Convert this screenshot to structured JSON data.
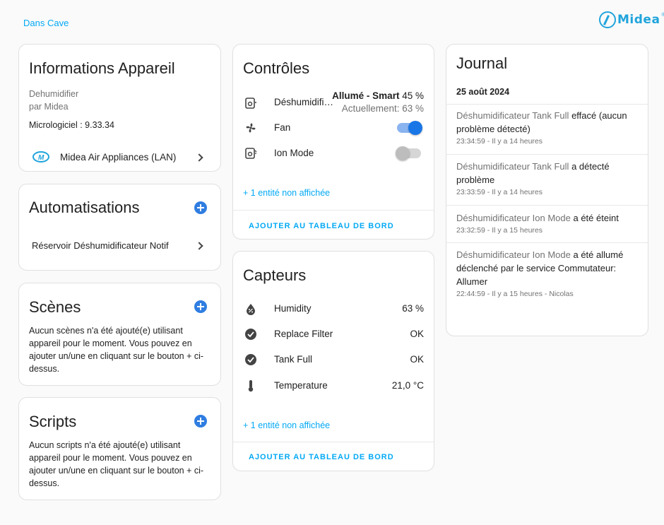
{
  "header": {
    "area_link": "Dans Cave",
    "brand_name": "Midea",
    "brand_reg": "®",
    "brand_color": "#20a4dc"
  },
  "device_info": {
    "title": "Informations Appareil",
    "model": "Dehumidifier",
    "manufacturer": "par Midea",
    "firmware": "Micrologiciel : 9.33.34",
    "integration": "Midea Air Appliances (LAN)"
  },
  "automations": {
    "title": "Automatisations",
    "items": [
      "Réservoir Déshumidificateur Notif"
    ]
  },
  "scenes": {
    "title": "Scènes",
    "empty_text": "Aucun scènes n'a été ajouté(e) utilisant appareil pour le moment. Vous pouvez en ajouter un/une en cliquant sur le bouton + ci-dessus."
  },
  "scripts": {
    "title": "Scripts",
    "empty_text": "Aucun scripts n'a été ajouté(e) utilisant appareil pour le moment. Vous pouvez en ajouter un/une en cliquant sur le bouton + ci-dessus."
  },
  "controls": {
    "title": "Contrôles",
    "entities": [
      {
        "name": "Déshumidific…",
        "state_bold": "Allumé - Smart",
        "state_value": "45 %",
        "state_secondary": "Actuellement: 63 %",
        "icon": "dehumidifier-icon"
      },
      {
        "name": "Fan",
        "toggle": "on",
        "icon": "fan-icon"
      },
      {
        "name": "Ion Mode",
        "toggle": "off",
        "icon": "ion-mode-icon"
      }
    ],
    "more_link": "+ 1 entité non affichée",
    "add_button": "AJOUTER AU TABLEAU DE BORD"
  },
  "sensors": {
    "title": "Capteurs",
    "entities": [
      {
        "name": "Humidity",
        "state": "63 %",
        "icon": "water-percent-icon"
      },
      {
        "name": "Replace Filter",
        "state": "OK",
        "icon": "check-circle-icon"
      },
      {
        "name": "Tank Full",
        "state": "OK",
        "icon": "check-circle-icon"
      },
      {
        "name": "Temperature",
        "state": "21,0 °C",
        "icon": "thermometer-icon"
      }
    ],
    "more_link": "+ 1 entité non affichée",
    "add_button": "AJOUTER AU TABLEAU DE BORD"
  },
  "journal": {
    "title": "Journal",
    "date": "25 août 2024",
    "entries": [
      {
        "entity": "Déshumidificateur Tank Full",
        "message": "effacé (aucun problème détecté)",
        "time": "23:34:59 - Il y a 14 heures"
      },
      {
        "entity": "Déshumidificateur Tank Full",
        "message": "a détecté problème",
        "time": "23:33:59 - Il y a 14 heures"
      },
      {
        "entity": "Déshumidificateur Ion Mode",
        "message": "a été éteint",
        "time": "23:32:59 - Il y a 15 heures"
      },
      {
        "entity": "Déshumidificateur Ion Mode",
        "message": "a été allumé déclenché par le service Commutateur: Allumer",
        "time": "22:44:59 - Il y a 15 heures - Nicolas"
      }
    ]
  },
  "colors": {
    "accent": "#03a9f4",
    "primary": "#2f7de1",
    "toggle_on": "#1976e6"
  }
}
